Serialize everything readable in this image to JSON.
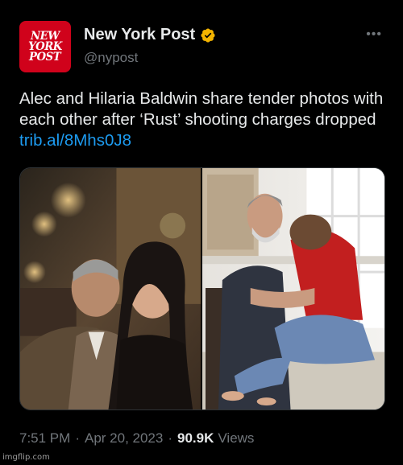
{
  "account": {
    "display_name": "New York Post",
    "handle": "@nypost",
    "verified_badge_color": "#f4b400",
    "avatar_color": "#d0021b",
    "avatar_logo_lines": [
      "NEW",
      "YORK",
      "POST"
    ],
    "more_icon": "ellipsis-icon"
  },
  "tweet": {
    "text": "Alec and Hilaria Baldwin share tender photos with each other after ‘Rust’ shooting charges dropped",
    "link": "trib.al/8Mhs0J8",
    "link_color": "#1d9bf0"
  },
  "media": {
    "photo_count": 2
  },
  "meta": {
    "time": "7:51 PM",
    "date": "Apr 20, 2023",
    "separator": "·",
    "views_count": "90.9K",
    "views_label": "Views"
  },
  "watermark": "imgflip.com"
}
